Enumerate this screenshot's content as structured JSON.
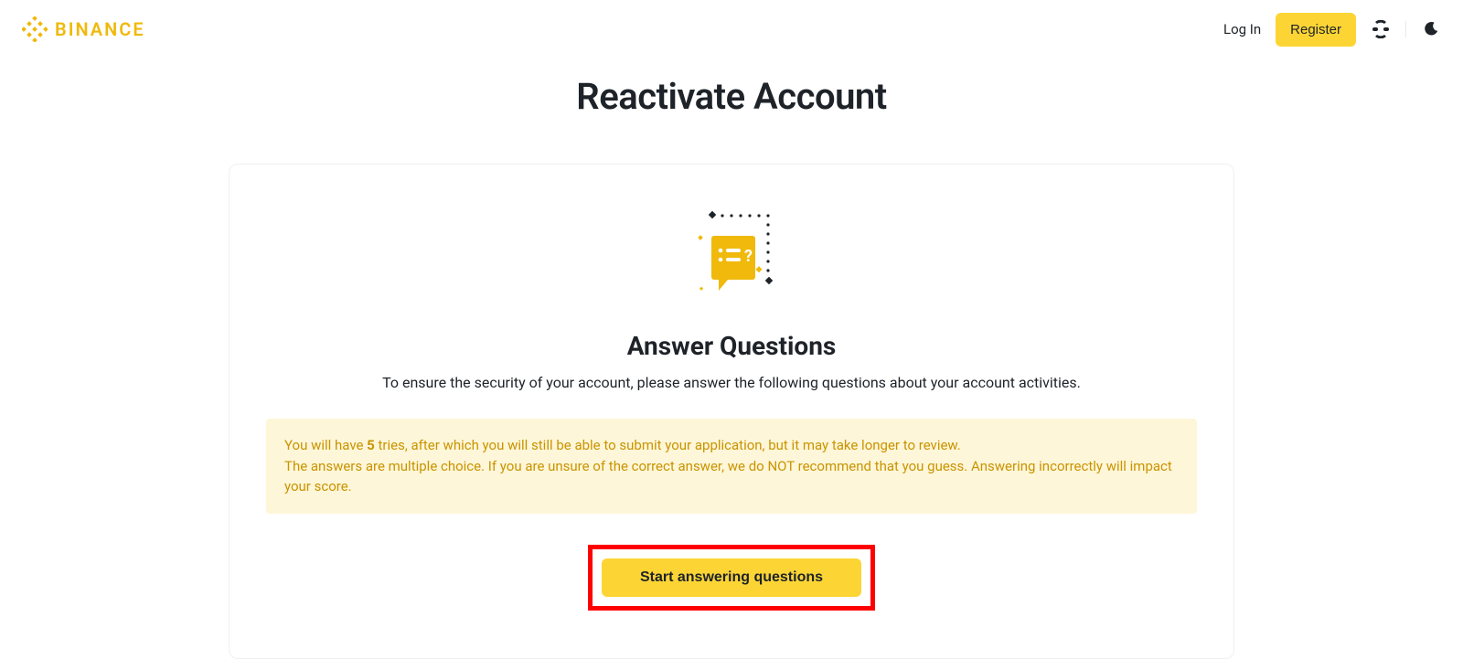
{
  "header": {
    "brand": "BINANCE",
    "login_label": "Log In",
    "register_label": "Register"
  },
  "page": {
    "title": "Reactivate Account"
  },
  "main": {
    "section_title": "Answer Questions",
    "section_desc": "To ensure the security of your account, please answer the following questions about your account activities.",
    "notice": {
      "line1_prefix": "You will have ",
      "tries_count": "5",
      "line1_suffix": " tries, after which you will still be able to submit your application, but it may take longer to review.",
      "line2": "The answers are multiple choice. If you are unsure of the correct answer, we do NOT recommend that you guess. Answering incorrectly will impact your score."
    },
    "cta_label": "Start answering questions"
  },
  "colors": {
    "accent": "#fcd535",
    "brand": "#f0b90b",
    "notice_bg": "#fef6d8",
    "notice_text": "#c99400",
    "highlight_border": "#ff0000"
  }
}
